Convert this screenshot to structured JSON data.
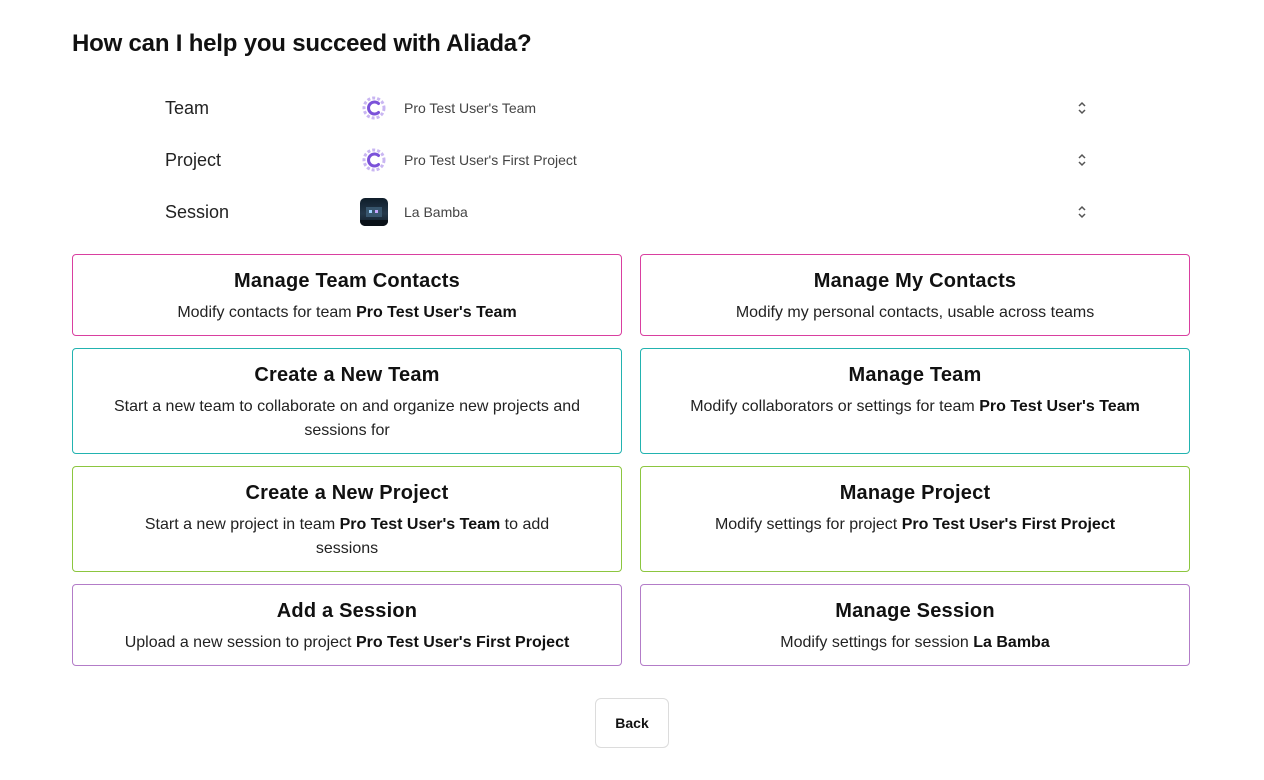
{
  "page": {
    "title": "How can I help you succeed with Aliada?"
  },
  "selectors": [
    {
      "label": "Team",
      "value": "Pro Test User's Team",
      "icon": "team-logo-icon"
    },
    {
      "label": "Project",
      "value": "Pro Test User's First Project",
      "icon": "project-logo-icon"
    },
    {
      "label": "Session",
      "value": "La Bamba",
      "icon": "session-thumbnail"
    }
  ],
  "cards": [
    {
      "title": "Manage Team Contacts",
      "desc_pre": "Modify contacts for team ",
      "desc_bold": "Pro Test User's Team",
      "desc_post": "",
      "color": "#d93fa0"
    },
    {
      "title": "Manage My Contacts",
      "desc_pre": "Modify my personal contacts, usable across teams",
      "desc_bold": "",
      "desc_post": "",
      "color": "#d93fa0"
    },
    {
      "title": "Create a New Team",
      "desc_pre": "Start a new team to collaborate on and organize new projects and sessions for",
      "desc_bold": "",
      "desc_post": "",
      "color": "#22b3b0"
    },
    {
      "title": "Manage Team",
      "desc_pre": "Modify collaborators or settings for team ",
      "desc_bold": "Pro Test User's Team",
      "desc_post": "",
      "color": "#22b3b0"
    },
    {
      "title": "Create a New Project",
      "desc_pre": "Start a new project in team ",
      "desc_bold": "Pro Test User's Team",
      "desc_post": " to add sessions",
      "color": "#8cc63f"
    },
    {
      "title": "Manage Project",
      "desc_pre": "Modify settings for project ",
      "desc_bold": "Pro Test User's First Project",
      "desc_post": "",
      "color": "#8cc63f"
    },
    {
      "title": "Add a Session",
      "desc_pre": "Upload a new session to project ",
      "desc_bold": "Pro Test User's First Project",
      "desc_post": "",
      "color": "#b37cc8"
    },
    {
      "title": "Manage Session",
      "desc_pre": "Modify settings for session ",
      "desc_bold": "La Bamba",
      "desc_post": "",
      "color": "#b37cc8"
    }
  ],
  "back_button": {
    "label": "Back"
  }
}
